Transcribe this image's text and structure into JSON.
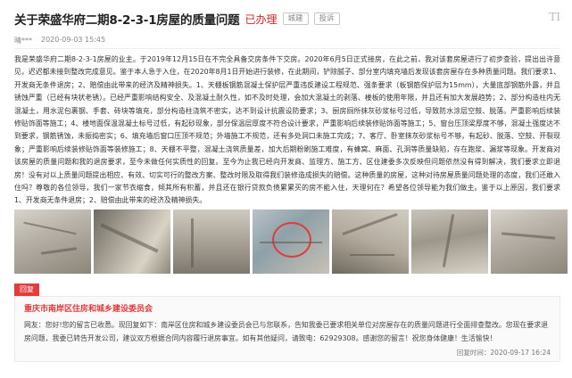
{
  "header": {
    "title": "关于荣盛华府二期8-2-3-1房屋的质量问题",
    "status": "已办理",
    "tags": [
      "城建",
      "投诉"
    ],
    "font_icon": "TI"
  },
  "meta": {
    "author": "晴***",
    "time": "2020-09-03 15:45"
  },
  "body": "我是荣盛华府二期8-2-3-1房屋的业主。于2019年12月15日在不完全具备交房条件下交房。2020年6月5日正式接房，在此之前，我对该套房屋进行了初步查验，提出出许意见，迟迟都未接到整改完成意见。鉴于本人急于入住，在2020年8月1日开始进行装修，在此期间，铲除腻子、部分室内填充墙后发现该套房屋存在多种质量问题。我们要求1、开发商无条件退房；2、赔偿由此带来的经济及精神损失。1、天棚板钢筋混凝土保护层严重违反建设工程规范、强条要求（板钢筋保护层为15mm），大量底部钢筋外露，并且锈蚀严重（已经有块状老锈）。已经严重影响结构安全、及混凝土耐久性，如不及时处理，会加大混凝土的剥落、楼板的使用年限，并且还有加大发展趋势；2、部分构造柱内无混凝土，用水泥包裹钢、手套、砖块等填充，部分构造柱浇筑不密实，达不到设计抗震设防要求；3、厨房厕所抹灰砂浆标号过低，导致防水涂层空鼓、脱落。严重影响后续装修贴饰面等施工；4、楼地面保温混凝土标号过低，有起砂现象，部分保温层厚度不符合设计要求，严重影响后续装修贴饰面等施工；5、窗台压顶梁厚度不够，混凝土强度达不到要求，钢筋锈蚀，未振捣密实；6、填充墙后窗口压顶不规范；外墙施工不规范，还有多处洞口未施工完成；7、客厅、卧室抹灰砂浆标号不够，有起砂、脱落、空鼓、开裂现象；严重影响后续装修贴饰面等装修施工；8、天棚不平整，混凝土浇筑质量差，加大后期粉刷施工难度，有蜂窝、麻面、孔洞等质量缺陷，存在跑浆、漏浆等现象。开发商对该房屋的质量问题和我的退房要求，至今未做任何实质性的回复。至今为止我已经向开发商、监理方、施工方、区住建委多次反映但问题依然没有得到解决，我们要求立即退房！没有对以上质量问题提出相应、有效、切实可行的整改方案、整改时限及取得我们装修造成损失的赔偿。这种质量的房屋，这种对待房屋质量问题处理的态度，我们还敢入住吗？尊敬的各位领导，我们一家节衣缩食，倾其所有积蓄，并且还在银行贷款负债累累买的房不能入住，天理何在？希望各位领导能为我们做主。鉴于以上原因，我们要求1、开发商无条件退房；2、赔偿由此带来的经济及精神损失。",
  "photos": [
    "photo-1",
    "photo-2",
    "photo-3",
    "photo-4",
    "photo-5",
    "photo-6",
    "photo-7"
  ],
  "reply": {
    "badge": "回复",
    "org": "重庆市南岸区住房和城乡建设委员会",
    "text": "网友：您好!您的留言已收悉。现回复如下：南岸区住房和城乡建设委员会已与您联系，告知我委已要求相关单位对房屋存在的质量问题进行全面排查整改。您现在要求退房问题，我委已转告开发公司，建议双方根据合同内容履行退房事宜。如有其他疑问，请致电：62929308。感谢您的留言！祝您身体健康！生活愉快！",
    "time_label": "回复时间：",
    "time": "2020-09-17 16:24"
  }
}
